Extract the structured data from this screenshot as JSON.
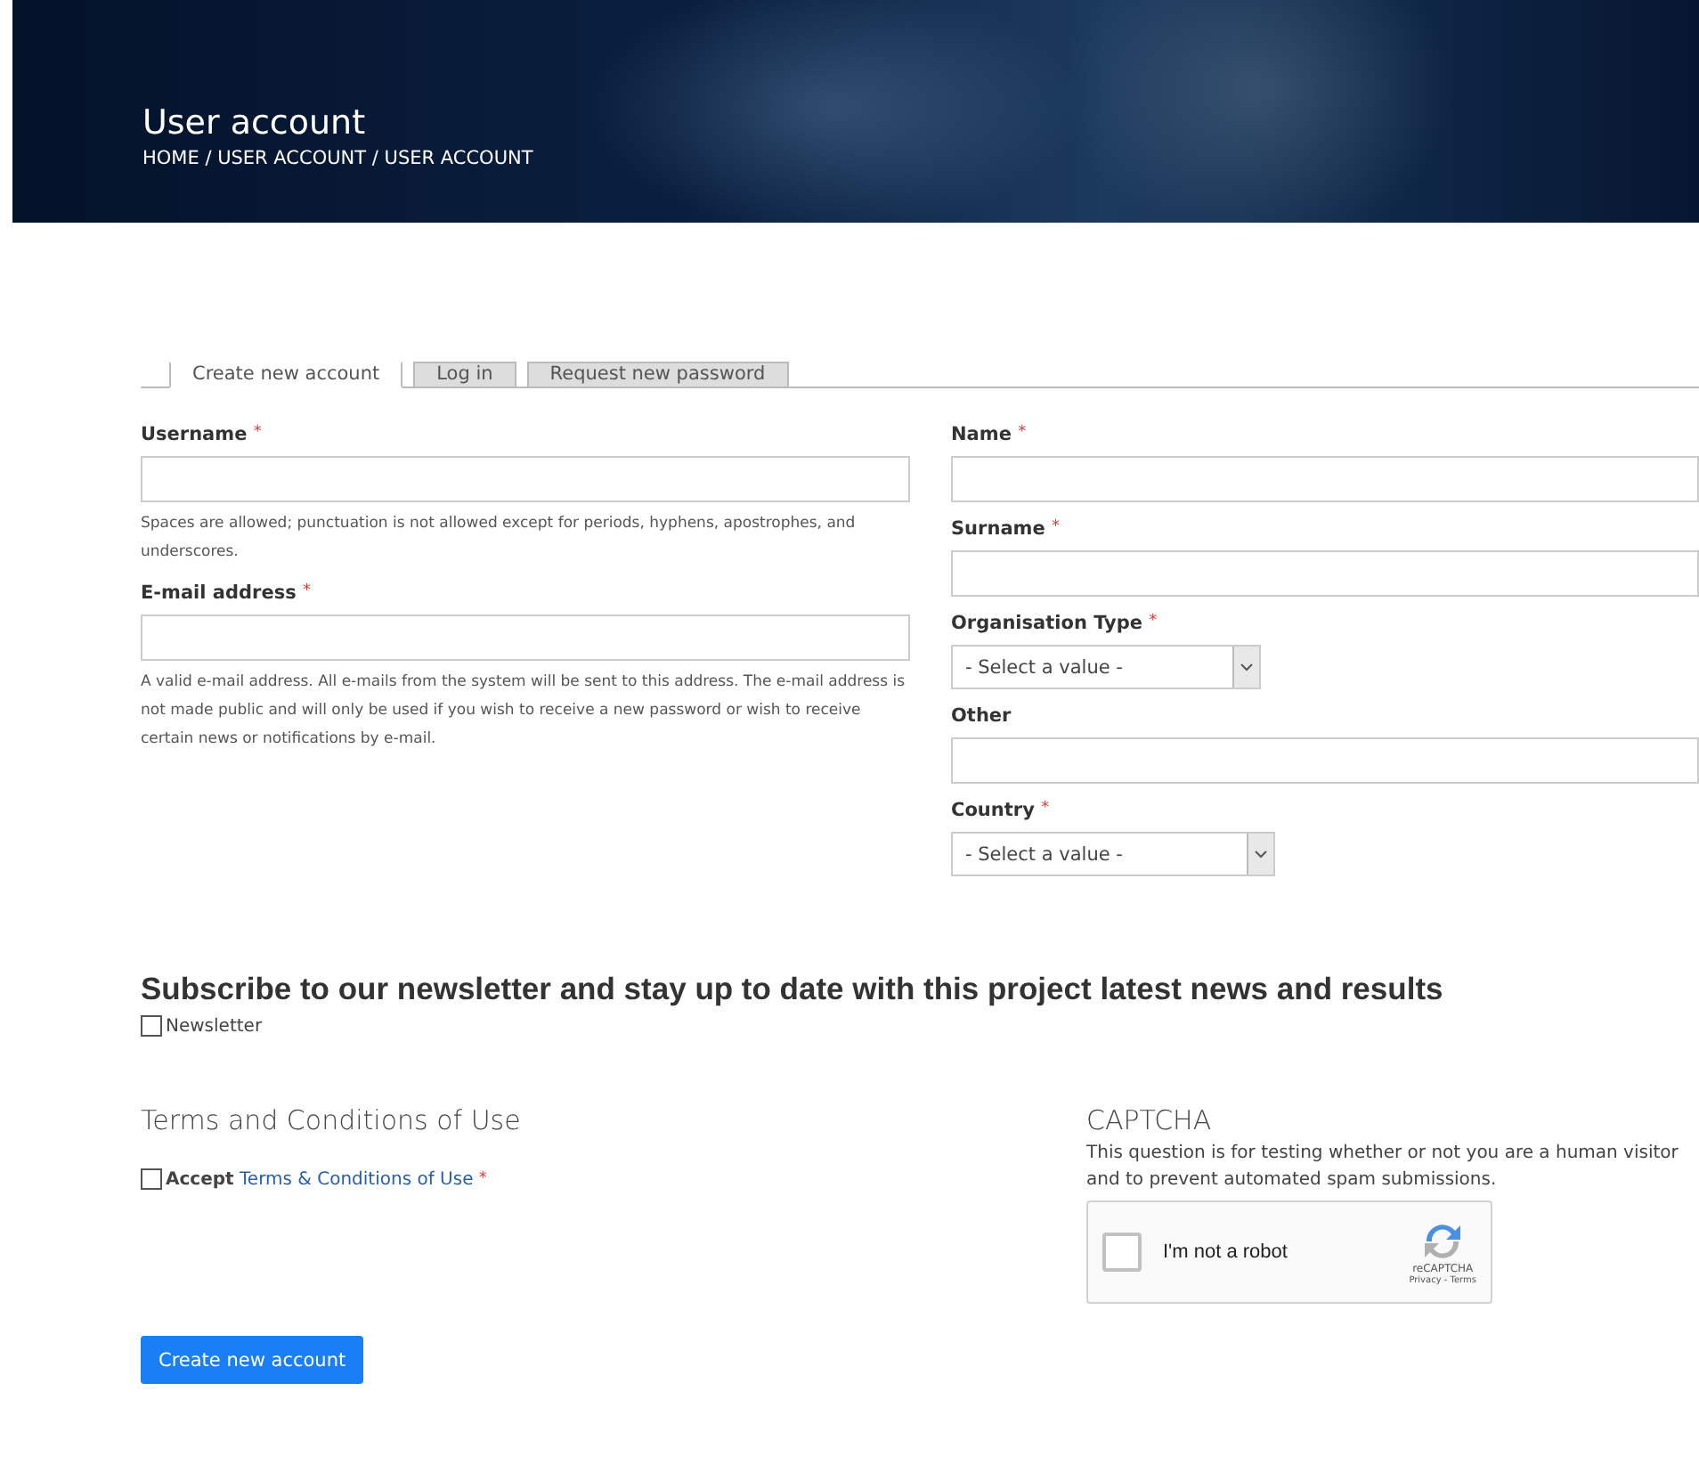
{
  "header": {
    "title": "User account",
    "breadcrumb": "HOME / USER ACCOUNT / USER ACCOUNT"
  },
  "tabs": [
    {
      "label": "Create new account",
      "selected": true
    },
    {
      "label": "Log in",
      "selected": false
    },
    {
      "label": "Request new password",
      "selected": false
    }
  ],
  "left_fields": [
    {
      "kind": "text",
      "label": "Username",
      "required_mark": "*",
      "help": "Spaces are allowed; punctuation is not allowed except for periods, hyphens, apostrophes, and underscores."
    },
    {
      "kind": "text",
      "label": "E-mail address",
      "required_mark": "*",
      "help": "A valid e-mail address. All e-mails from the system will be sent to this address. The e-mail address is not made public and will only be used if you wish to receive a new password or wish to receive certain news or notifications by e-mail."
    }
  ],
  "right_fields": [
    {
      "kind": "text",
      "label": "Name",
      "required_mark": "*"
    },
    {
      "kind": "text",
      "label": "Surname",
      "required_mark": "*"
    },
    {
      "kind": "select",
      "label": "Organisation Type",
      "required_mark": "*",
      "value": "- Select a value -"
    },
    {
      "kind": "text",
      "label": "Other"
    },
    {
      "kind": "select",
      "label": "Country",
      "required_mark": "*",
      "value": "- Select a value -"
    }
  ],
  "newsletter": {
    "heading": "Subscribe to our newsletter and stay up to date with this project latest news and results",
    "label": "Newsletter",
    "checked": false
  },
  "terms": {
    "heading": "Terms and Conditions of Use",
    "bold": "Accept",
    "link": "Terms & Conditions of Use",
    "required_mark": "*",
    "checked": false
  },
  "captcha": {
    "heading": "CAPTCHA",
    "description": "This question is for testing whether or not you are a human visitor and to prevent automated spam submissions.",
    "label": "I'm not a robot",
    "checked": false,
    "brand": "reCAPTCHA",
    "links": "Privacy - Terms"
  },
  "submit": "Create new account"
}
